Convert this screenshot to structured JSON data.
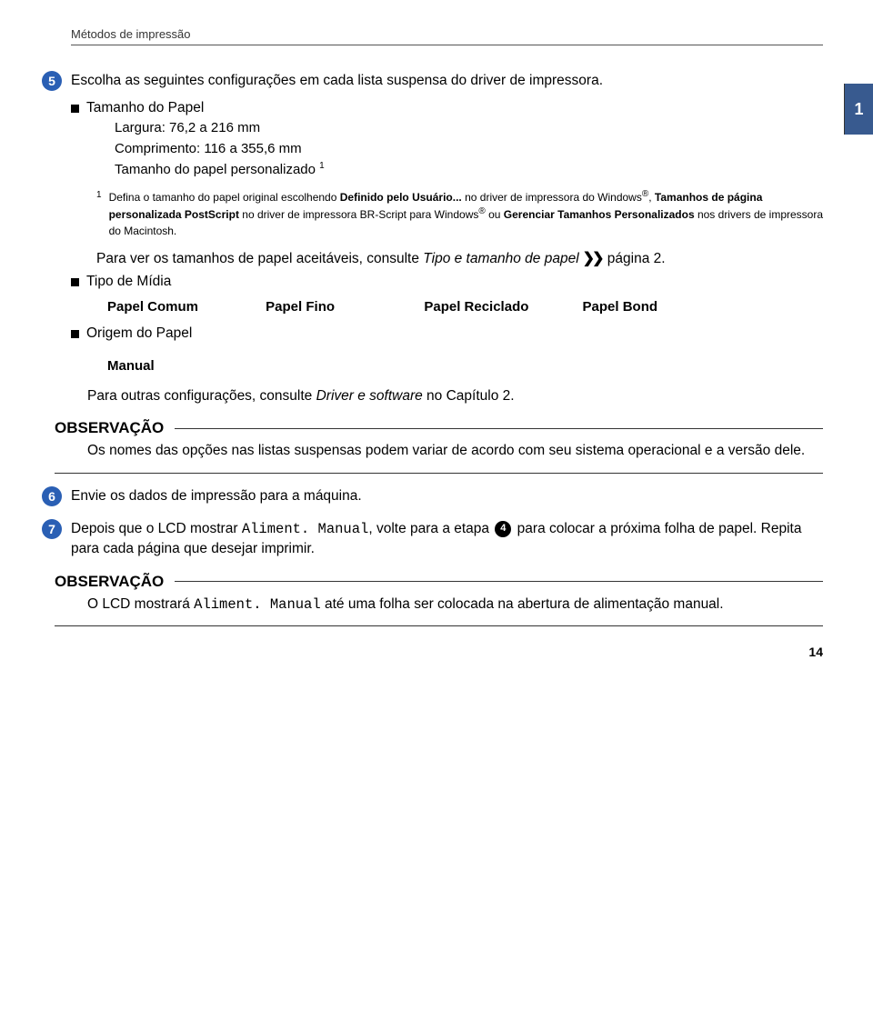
{
  "breadcrumb": "Métodos de impressão",
  "section_number": "1",
  "step5": {
    "num": "5",
    "text": "Escolha as seguintes configurações em cada lista suspensa do driver de impressora."
  },
  "paper_size": {
    "title": "Tamanho do Papel",
    "width": "Largura: 76,2 a 216 mm",
    "length": "Comprimento: 116 a 355,6 mm",
    "custom": "Tamanho do papel personalizado",
    "custom_mark": "1"
  },
  "footnote": {
    "mark": "1",
    "part1": "Defina o tamanho do papel original escolhendo ",
    "bold1": "Definido pelo Usuário...",
    "part2": " no driver de impressora do Windows",
    "part3": ", ",
    "bold2": "Tamanhos de página personalizada PostScript",
    "part4": " no driver de impressora BR-Script para Windows",
    "part5": " ou ",
    "bold3": "Gerenciar Tamanhos Personalizados",
    "part6": " nos drivers de impressora do Macintosh."
  },
  "acceptable": {
    "part1": "Para ver os tamanhos de papel aceitáveis, consulte ",
    "italic": "Tipo e tamanho de papel",
    "part2": " página 2."
  },
  "media_type_title": "Tipo de Mídia",
  "media_types": {
    "a": "Papel Comum",
    "b": "Papel Fino",
    "c": "Papel Reciclado",
    "d": "Papel Bond"
  },
  "paper_source_title": "Origem do Papel",
  "paper_source_value": "Manual",
  "other_settings": {
    "part1": "Para outras configurações, consulte ",
    "italic": "Driver e software",
    "part2": " no Capítulo 2."
  },
  "note_title": "OBSERVAÇÃO",
  "note1_body": "Os nomes das opções nas listas suspensas podem variar de acordo com seu sistema operacional e a versão dele.",
  "step6": {
    "num": "6",
    "text": "Envie os dados de impressão para a máquina."
  },
  "step7": {
    "num": "7",
    "part1": "Depois que o LCD mostrar ",
    "mono1": "Aliment. Manual",
    "part2": ", volte para a etapa ",
    "inline_num": "4",
    "part3": " para colocar a próxima folha de papel. Repita para cada página que desejar imprimir."
  },
  "note2": {
    "part1": "O LCD mostrará ",
    "mono1": "Aliment. Manual",
    "part2": " até uma folha ser colocada na abertura de alimentação manual."
  },
  "page_number": "14"
}
